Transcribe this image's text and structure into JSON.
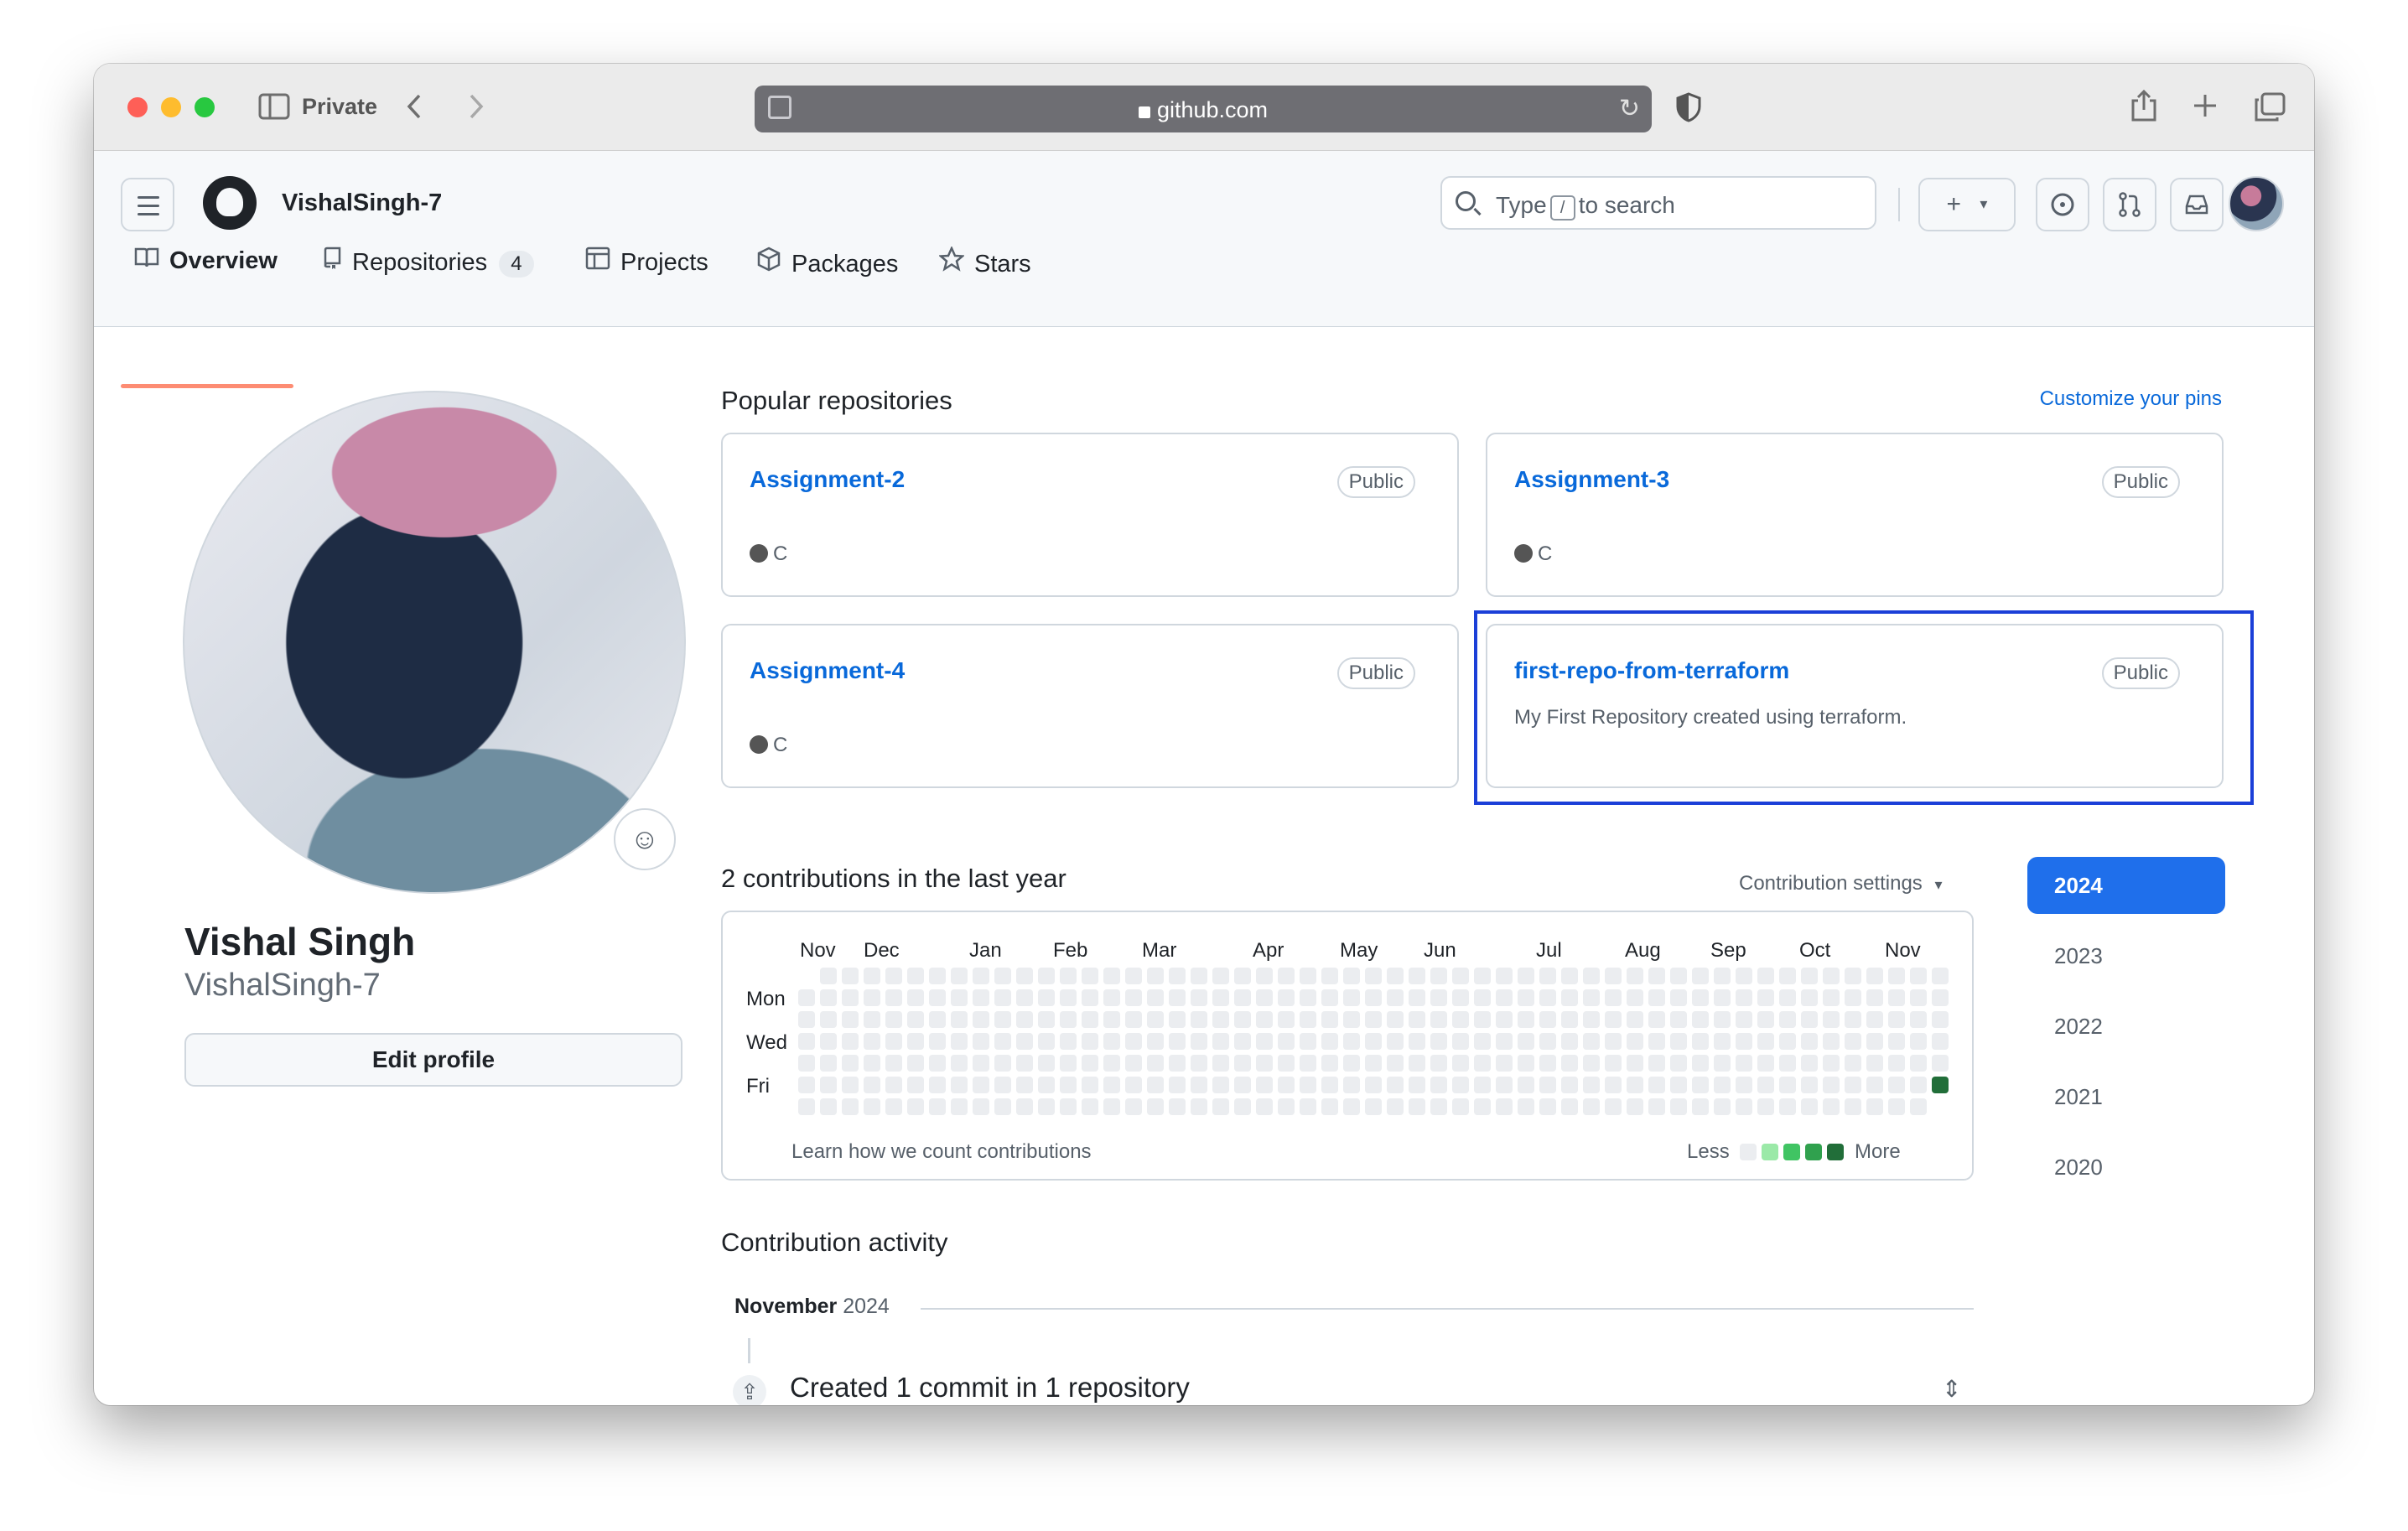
{
  "browser": {
    "private_label": "Private",
    "url": "github.com"
  },
  "header": {
    "username": "VishalSingh-7",
    "search_prefix": "Type",
    "search_key": "/",
    "search_suffix": "to search",
    "plus_icon": "plus-icon",
    "dropdown_icon": "triangle-down-icon"
  },
  "tabs": [
    {
      "label": "Overview",
      "icon": "book-icon",
      "active": true
    },
    {
      "label": "Repositories",
      "icon": "repo-icon",
      "count": "4"
    },
    {
      "label": "Projects",
      "icon": "table-icon"
    },
    {
      "label": "Packages",
      "icon": "package-icon"
    },
    {
      "label": "Stars",
      "icon": "star-icon"
    }
  ],
  "profile": {
    "full_name": "Vishal Singh",
    "login": "VishalSingh-7",
    "edit_button": "Edit profile"
  },
  "popular": {
    "title": "Popular repositories",
    "customize": "Customize your pins",
    "repos": [
      {
        "name": "Assignment-2",
        "visibility": "Public",
        "language": "C"
      },
      {
        "name": "Assignment-3",
        "visibility": "Public",
        "language": "C"
      },
      {
        "name": "Assignment-4",
        "visibility": "Public",
        "language": "C"
      },
      {
        "name": "first-repo-from-terraform",
        "visibility": "Public",
        "description": "My First Repository created using terraform."
      }
    ],
    "language_color": "#555555"
  },
  "contributions": {
    "title": "2 contributions in the last year",
    "settings": "Contribution settings",
    "months": [
      "Nov",
      "Dec",
      "Jan",
      "Feb",
      "Mar",
      "Apr",
      "May",
      "Jun",
      "Jul",
      "Aug",
      "Sep",
      "Oct",
      "Nov"
    ],
    "days": [
      "Mon",
      "Wed",
      "Fri"
    ],
    "learn": "Learn how we count contributions",
    "legend_less": "Less",
    "legend_more": "More",
    "level_colors": [
      "#ebedf0",
      "#9be9a8",
      "#40c463",
      "#30a14e",
      "#216e39"
    ],
    "active_cell": {
      "week": 52,
      "day": 5,
      "level": 4
    },
    "years": [
      "2024",
      "2023",
      "2022",
      "2021",
      "2020"
    ],
    "selected_year": "2024"
  },
  "activity": {
    "title": "Contribution activity",
    "month": "November",
    "year": "2024",
    "event": "Created 1 commit in 1 repository"
  }
}
